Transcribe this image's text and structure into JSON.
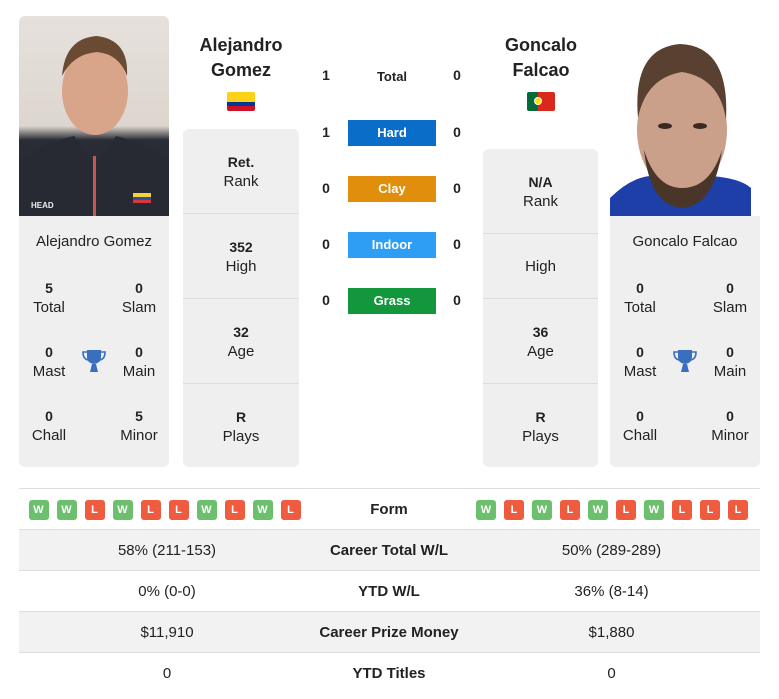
{
  "player1": {
    "name_line1": "Alejandro",
    "name_line2": "Gomez",
    "full_name": "Alejandro Gomez",
    "country": "Colombia",
    "rank": "Ret.",
    "rank_label": "Rank",
    "high": "352",
    "high_label": "High",
    "age": "32",
    "age_label": "Age",
    "plays": "R",
    "plays_label": "Plays",
    "titles": {
      "total": "5",
      "total_label": "Total",
      "slam": "0",
      "slam_label": "Slam",
      "mast": "0",
      "mast_label": "Mast",
      "main": "0",
      "main_label": "Main",
      "chall": "0",
      "chall_label": "Chall",
      "minor": "5",
      "minor_label": "Minor"
    },
    "form": [
      "W",
      "W",
      "L",
      "W",
      "L",
      "L",
      "W",
      "L",
      "W",
      "L"
    ]
  },
  "player2": {
    "name_line1": "Goncalo",
    "name_line2": "Falcao",
    "full_name": "Goncalo Falcao",
    "country": "Portugal",
    "rank": "N/A",
    "rank_label": "Rank",
    "high": "",
    "high_label": "High",
    "age": "36",
    "age_label": "Age",
    "plays": "R",
    "plays_label": "Plays",
    "titles": {
      "total": "0",
      "total_label": "Total",
      "slam": "0",
      "slam_label": "Slam",
      "mast": "0",
      "mast_label": "Mast",
      "main": "0",
      "main_label": "Main",
      "chall": "0",
      "chall_label": "Chall",
      "minor": "0",
      "minor_label": "Minor"
    },
    "form": [
      "W",
      "L",
      "W",
      "L",
      "W",
      "L",
      "W",
      "L",
      "L",
      "L"
    ]
  },
  "h2h": {
    "total": {
      "label": "Total",
      "p1": "1",
      "p2": "0"
    },
    "surfaces": [
      {
        "label": "Hard",
        "p1": "1",
        "p2": "0",
        "color": "#0a6ec8"
      },
      {
        "label": "Clay",
        "p1": "0",
        "p2": "0",
        "color": "#e08e0b"
      },
      {
        "label": "Indoor",
        "p1": "0",
        "p2": "0",
        "color": "#2e9ef4"
      },
      {
        "label": "Grass",
        "p1": "0",
        "p2": "0",
        "color": "#13973c"
      }
    ]
  },
  "table": {
    "form_label": "Form",
    "rows": [
      {
        "label": "Career Total W/L",
        "p1": "58% (211-153)",
        "p2": "50% (289-289)"
      },
      {
        "label": "YTD W/L",
        "p1": "0% (0-0)",
        "p2": "36% (8-14)"
      },
      {
        "label": "Career Prize Money",
        "p1": "$11,910",
        "p2": "$1,880"
      },
      {
        "label": "YTD Titles",
        "p1": "0",
        "p2": "0"
      }
    ]
  },
  "icons": {
    "trophy": "trophy-icon"
  },
  "colors": {
    "win": "#6cbf6c",
    "loss": "#ee5b3f",
    "trophy": "#3a6fc0",
    "card_bg": "#efefef"
  }
}
